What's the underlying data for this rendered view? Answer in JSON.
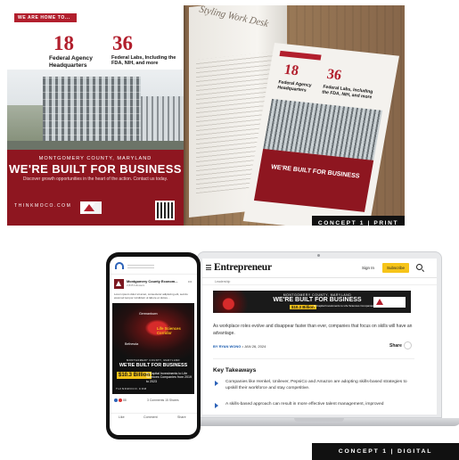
{
  "print": {
    "flyer": {
      "strip": "WE ARE HOME TO...",
      "stat1_num": "18",
      "stat1_label": "Federal Agency Headquarters",
      "stat2_num": "36",
      "stat2_label": "Federal Labs, Including the FDA, NIH, and more",
      "county": "MONTGOMERY COUNTY, MARYLAND",
      "headline": "WE'RE BUILT FOR BUSINESS",
      "tagline": "Discover growth opportunities in the heart of the action. Contact us today.",
      "url": "THINKMOCO.COM"
    },
    "magazine": {
      "left_heading": "Styling Work Desk",
      "stat1_num": "18",
      "stat1_label": "Federal Agency Headquarters",
      "stat2_num": "36",
      "stat2_label": "Federal Labs, Including the FDA, NIH, and more",
      "headline": "WE'RE BUILT FOR BUSINESS"
    },
    "tag": "CONCEPT 1 | PRINT"
  },
  "digital": {
    "site": {
      "logo": "Entrepreneur",
      "sign_in": "Sign In",
      "subscribe": "Subscribe",
      "subnav": "Leadership",
      "ad": {
        "county": "MONTGOMERY COUNTY, MARYLAND",
        "headline": "WE'RE BUILT FOR BUSINESS",
        "money": "$10.3 Billion",
        "money_label": "in Capital Investments to Life Sciences Companies from 2019 to 2023"
      },
      "lede": "As workplace roles evolve and disappear faster than ever, companies that focus on skills will have an advantage.",
      "byline_author": "BY RYAN WONG",
      "byline_date": "• JAN 26, 2024",
      "share": "Share",
      "takeaways_heading": "Key Takeaways",
      "bullets": [
        "Companies like Henkel, Unilever, PepsiCo and Amazon are adopting skills-based strategies to upskill their workforce and stay competitive.",
        "A skills-based approach can result in more effective talent management, improved"
      ]
    },
    "phone": {
      "page_name": "Montgomery County Econom...",
      "followers": "2,845 followers",
      "post_text": "Lorem ipsum dolor sit amet, consectetur adipiscing elit, sed do eiusmod tempor incididunt ut labore et dolore...",
      "ad": {
        "city1": "Germantown",
        "corridor": "Life Sciences Corridor",
        "city2": "Bethesda",
        "county": "MONTGOMERY COUNTY, MARYLAND",
        "headline": "WE'RE BUILT FOR BUSINESS",
        "money": "$10.3 Billion",
        "money_label": "in Capital Investments to Life Sciences Companies from 2019 to 2023",
        "url": "THINKMOCO.COM"
      },
      "reactions": "88",
      "stats": "3 Comments  15 Shares",
      "actions": [
        "Like",
        "Comment",
        "Share"
      ]
    },
    "tag": "CONCEPT 1 | DIGITAL"
  },
  "colors": {
    "brand_red": "#b21f2d",
    "dark_red": "#8e1620",
    "accent_yellow": "#f6c419",
    "link_blue": "#1c5db0"
  }
}
